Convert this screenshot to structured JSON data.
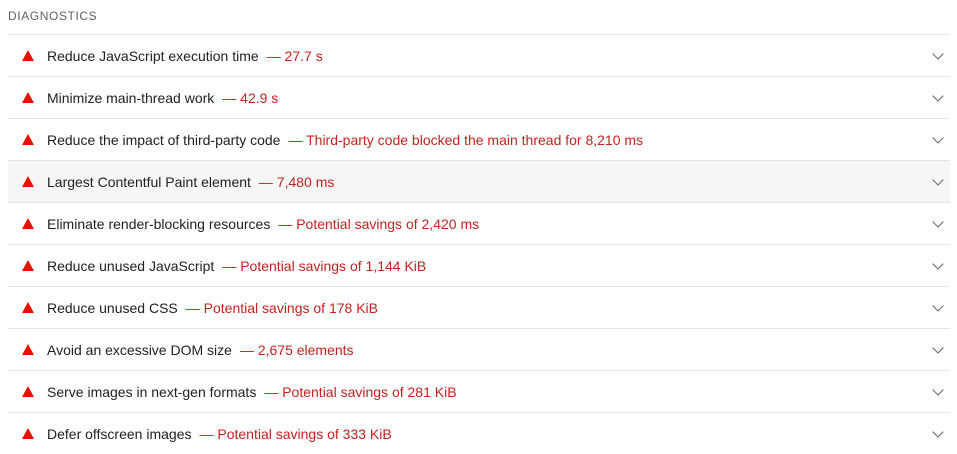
{
  "section": {
    "title": "DIAGNOSTICS"
  },
  "audits": [
    {
      "title": "Reduce JavaScript execution time",
      "display": "— 27.7 s",
      "status": "fail",
      "icon": "red-triangle-icon"
    },
    {
      "title": "Minimize main-thread work",
      "display": "— 42.9 s",
      "status": "fail",
      "icon": "red-triangle-icon"
    },
    {
      "title": "Reduce the impact of third-party code",
      "display": "— Third-party code blocked the main thread for 8,210 ms",
      "status": "fail",
      "icon": "red-triangle-icon"
    },
    {
      "title": "Largest Contentful Paint element",
      "display": "— 7,480 ms",
      "status": "fail",
      "icon": "red-triangle-icon",
      "hovered": true
    },
    {
      "title": "Eliminate render-blocking resources",
      "display": "— Potential savings of 2,420 ms",
      "status": "fail",
      "icon": "red-triangle-icon"
    },
    {
      "title": "Reduce unused JavaScript",
      "display": "— Potential savings of 1,144 KiB",
      "status": "fail",
      "icon": "red-triangle-icon"
    },
    {
      "title": "Reduce unused CSS",
      "display": "— Potential savings of 178 KiB",
      "status": "fail",
      "icon": "red-triangle-icon"
    },
    {
      "title": "Avoid an excessive DOM size",
      "display": "— 2,675 elements",
      "status": "fail",
      "icon": "red-triangle-icon"
    },
    {
      "title": "Serve images in next-gen formats",
      "display": "— Potential savings of 281 KiB",
      "status": "fail",
      "icon": "red-triangle-icon"
    },
    {
      "title": "Defer offscreen images",
      "display": "— Potential savings of 333 KiB",
      "status": "fail",
      "icon": "red-triangle-icon"
    }
  ],
  "colors": {
    "fail": "#eb0f00",
    "display_text": "#c5221f",
    "title_text": "#212121",
    "section_text": "#616161",
    "divider": "#e4e4e4",
    "hover_background": "#f6f6f6"
  }
}
